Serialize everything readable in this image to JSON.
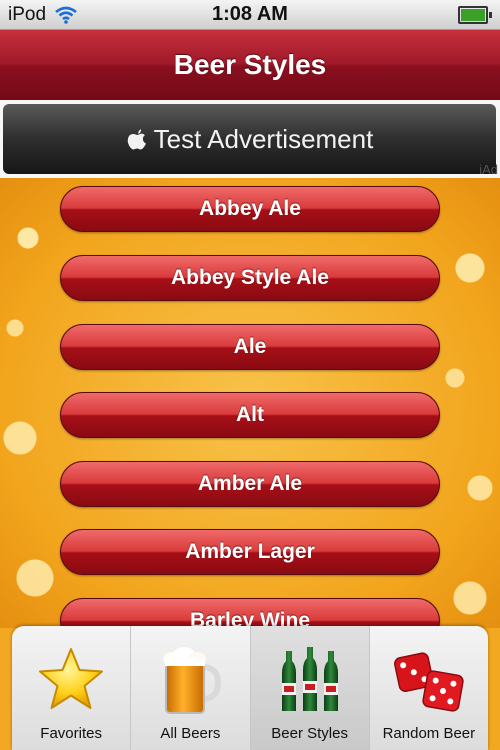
{
  "status_bar": {
    "carrier": "iPod",
    "time": "1:08 AM"
  },
  "nav": {
    "title": "Beer Styles"
  },
  "ad": {
    "text": "Test Advertisement",
    "tag": "iAd"
  },
  "styles": [
    {
      "label": "Abbey Ale"
    },
    {
      "label": "Abbey Style Ale"
    },
    {
      "label": "Ale"
    },
    {
      "label": "Alt"
    },
    {
      "label": "Amber Ale"
    },
    {
      "label": "Amber Lager"
    },
    {
      "label": "Barley Wine"
    }
  ],
  "tabs": [
    {
      "label": "Favorites",
      "icon": "star-icon"
    },
    {
      "label": "All Beers",
      "icon": "beer-mug-icon"
    },
    {
      "label": "Beer Styles",
      "icon": "beer-bottles-icon",
      "selected": true
    },
    {
      "label": "Random Beer",
      "icon": "dice-icon"
    }
  ],
  "colors": {
    "nav_red": "#a1192a",
    "button_red": "#d93b3b",
    "battery_green": "#3aa02a"
  }
}
